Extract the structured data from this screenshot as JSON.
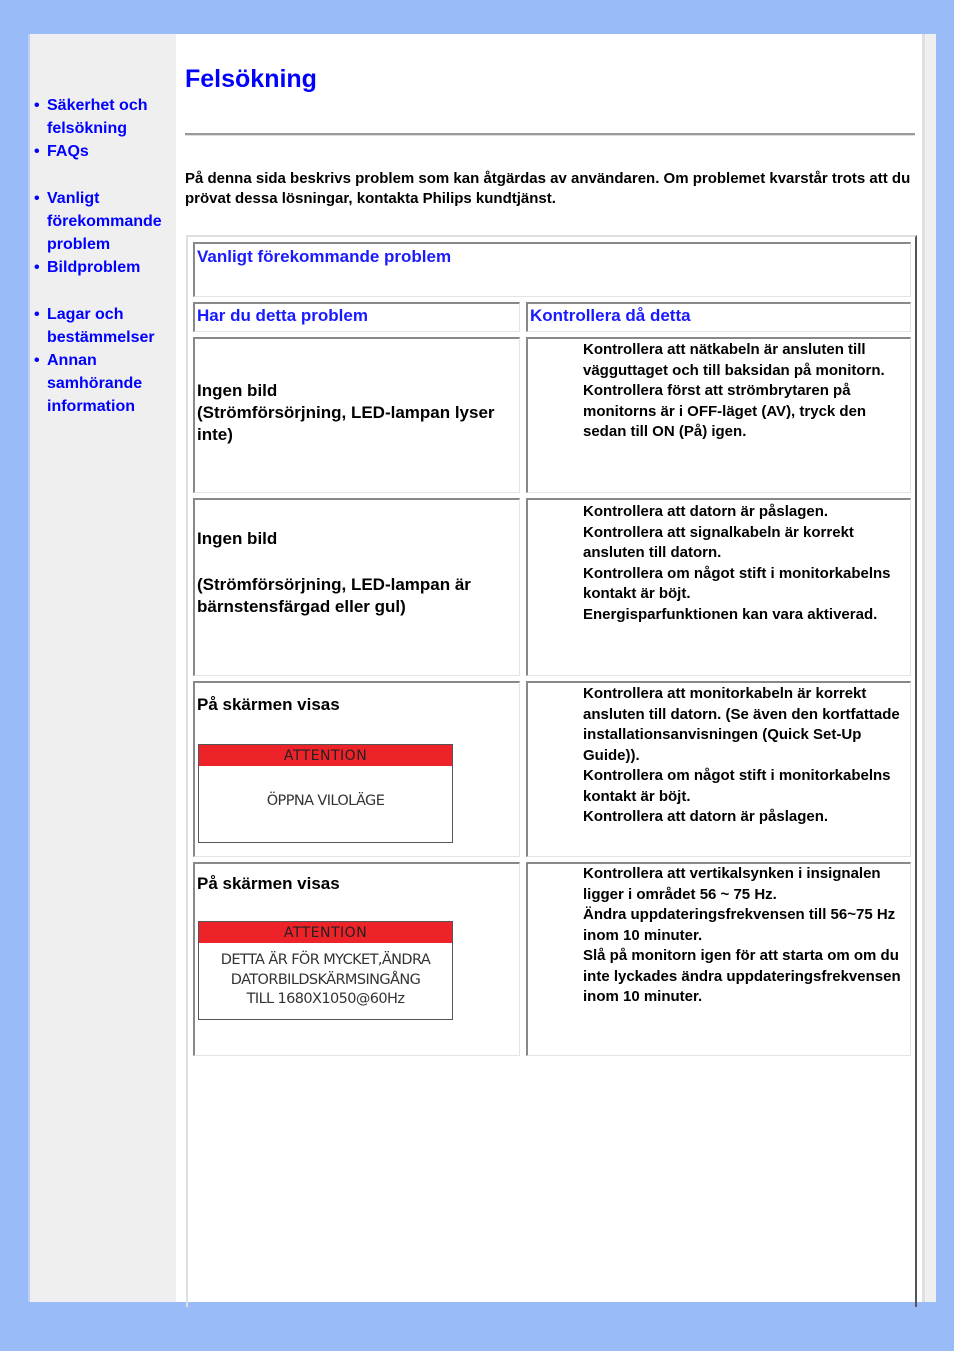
{
  "sidebar": {
    "items": [
      {
        "label": "Säkerhet och felsökning"
      },
      {
        "label": "FAQs"
      },
      {
        "label": "Vanligt förekommande problem"
      },
      {
        "label": "Bildproblem"
      },
      {
        "label": "Lagar och bestämmelser"
      },
      {
        "label": "Annan samhörande information"
      }
    ],
    "bullet": "•"
  },
  "page": {
    "title": "Felsökning",
    "intro": "På denna sida beskrivs problem som kan åtgärdas av användaren. Om problemet kvarstår trots att du prövat dessa lösningar, kontakta Philips kundtjänst."
  },
  "table": {
    "section_title": "Vanligt förekommande problem",
    "col_problem": "Har du detta problem",
    "col_check": "Kontrollera då detta",
    "rows": [
      {
        "problem_line1": "Ingen bild",
        "problem_line2": "(Strömförsörjning, LED-lampan lyser inte)",
        "checks": [
          "Kontrollera att nätkabeln är ansluten till vägguttaget och till baksidan på monitorn.",
          "Kontrollera först att strömbrytaren på monitorns är i OFF-läget (AV), tryck den sedan till ON (På) igen."
        ]
      },
      {
        "problem_line1": "Ingen bild",
        "problem_line2": "(Strömförsörjning, LED-lampan är bärnstensfärgad eller gul)",
        "checks": [
          "Kontrollera att datorn är påslagen.",
          "Kontrollera att signalkabeln är korrekt ansluten till datorn.",
          "Kontrollera om något stift i monitorkabelns kontakt är böjt.",
          "Energisparfunktionen kan vara aktiverad."
        ]
      },
      {
        "problem_line1": "På skärmen visas",
        "osd_title": "ATTENTION",
        "osd_message": [
          "ÖPPNA VILOLÄGE"
        ],
        "checks": [
          "Kontrollera att monitorkabeln är korrekt ansluten till datorn. (Se även den kortfattade installationsanvisningen (Quick Set-Up Guide)).",
          "Kontrollera om något stift i monitorkabelns kontakt är böjt.",
          "Kontrollera att datorn är påslagen."
        ]
      },
      {
        "problem_line1": "På skärmen visas",
        "osd_title": "ATTENTION",
        "osd_message": [
          "DETTA ÄR FÖR MYCKET,ÄNDRA",
          "DATORBILDSKÄRMSINGÅNG",
          "TILL 1680X1050@60Hz"
        ],
        "checks": [
          "Kontrollera att vertikalsynken i insignalen ligger i området 56 ~ 75 Hz.",
          "Ändra uppdateringsfrekvensen till 56~75 Hz inom 10 minuter.",
          "Slå på monitorn igen för att starta om om du inte lyckades ändra uppdateringsfrekvensen inom 10 minuter."
        ]
      }
    ]
  },
  "colors": {
    "background": "#99bbf7",
    "link": "#0000ff",
    "header_link": "#1a1aff",
    "osd_red": "#ee2229"
  }
}
